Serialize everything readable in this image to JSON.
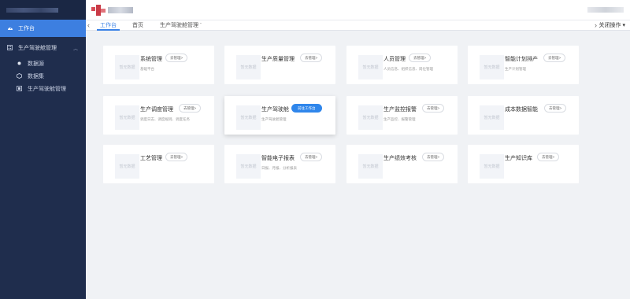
{
  "sidebar": {
    "active_label": "工作台",
    "group_label": "生产驾驶舱管理",
    "items": [
      {
        "label": "数据源",
        "icon": "dot-icon"
      },
      {
        "label": "数据集",
        "icon": "cube-icon"
      },
      {
        "label": "生产驾驶舱管理",
        "icon": "screen-icon"
      }
    ]
  },
  "tabs": {
    "items": [
      {
        "label": "工作台"
      },
      {
        "label": "首页"
      },
      {
        "label": "生产驾驶舱管理"
      }
    ],
    "close_ops_label": "关闭操作"
  },
  "cards": [
    {
      "title": "系统管理",
      "button": "去管理>",
      "desc": "基础平台"
    },
    {
      "title": "生产质量管理",
      "button": "去管理>",
      "desc": ""
    },
    {
      "title": "人员管理",
      "button": "去管理>",
      "desc": "人员信息、组织信息、岗位管理"
    },
    {
      "title": "智能计划排产",
      "button": "去管理>",
      "desc": "生产计划管理"
    },
    {
      "title": "生产调度管理",
      "button": "去管理>",
      "desc": "调度日志、调度规则、调度任务"
    },
    {
      "title": "生产驾驶舱",
      "button": "前往工作台",
      "desc": "生产驾驶舱管理"
    },
    {
      "title": "生产监控报警",
      "button": "去管理>",
      "desc": "生产监控、报警管理"
    },
    {
      "title": "成本数据智能",
      "button": "去管理>",
      "desc": ""
    },
    {
      "title": "工艺管理",
      "button": "去管理>",
      "desc": ""
    },
    {
      "title": "智能电子报表",
      "button": "去管理>",
      "desc": "日报、月报、分析报表"
    },
    {
      "title": "生产绩效考核",
      "button": "去管理>",
      "desc": ""
    },
    {
      "title": "生产知识库",
      "button": "去管理>",
      "desc": ""
    }
  ],
  "placeholder_label": "暂无数据",
  "colors": {
    "sidebar_bg": "#1f2d4d",
    "accent": "#3d7fe0",
    "primary_button": "#2f86eb"
  }
}
